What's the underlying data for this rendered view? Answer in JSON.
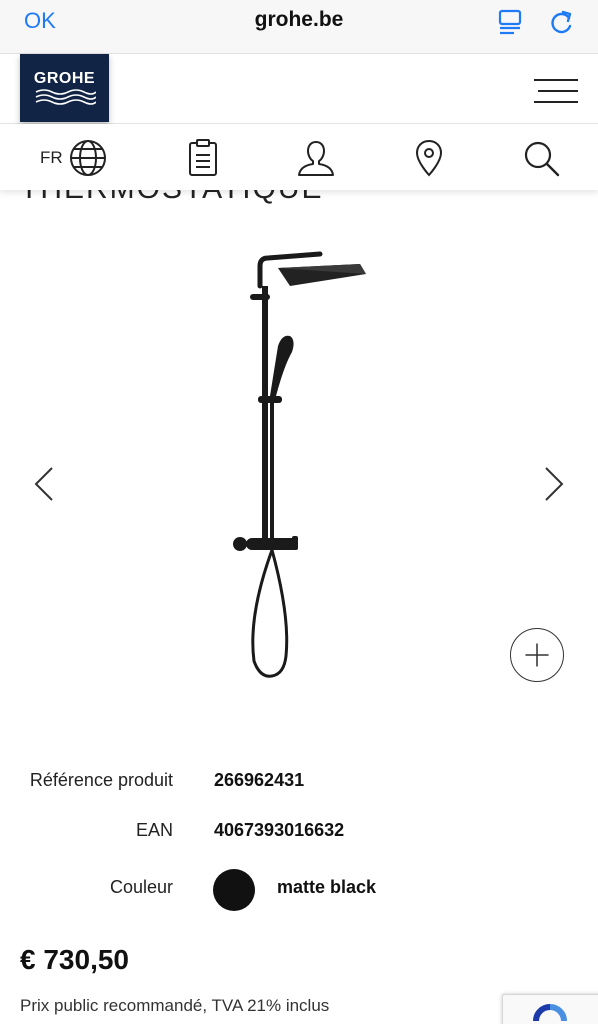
{
  "browser": {
    "ok_label": "OK",
    "url": "grohe.be",
    "reader_icon": "reader-list-icon",
    "reload_icon": "reload-icon"
  },
  "header": {
    "logo_text": "GROHE",
    "brand_color": "#112445",
    "menu_icon": "hamburger-menu-icon"
  },
  "nav": {
    "language": "FR",
    "icons": [
      "globe-icon",
      "clipboard-icon",
      "user-icon",
      "location-pin-icon",
      "search-icon"
    ]
  },
  "product": {
    "title_partial": "THERMOSTATIQUE",
    "gallery_icons": [
      "chevron-left-icon",
      "chevron-right-icon",
      "zoom-plus-icon"
    ],
    "details": {
      "reference_label": "Référence produit",
      "reference_value": "266962431",
      "ean_label": "EAN",
      "ean_value": "4067393016632",
      "color_label": "Couleur",
      "color_value": "matte black",
      "color_swatch": "#111111"
    },
    "price": "€ 730,50",
    "price_note": "Prix public recommandé, TVA 21% inclus"
  },
  "accent_color": "#1f7af5"
}
